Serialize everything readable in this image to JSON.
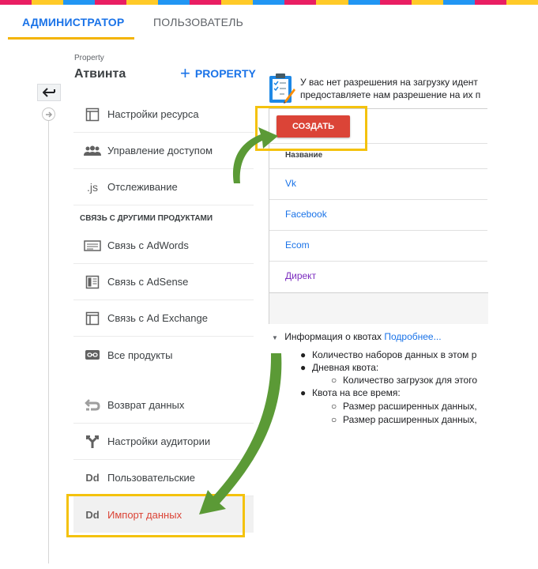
{
  "stripe": {
    "colors": [
      "#e91e63",
      "#ffca28",
      "#2196f3",
      "#e91e63",
      "#ffca28",
      "#2196f3",
      "#e91e63",
      "#ffca28",
      "#2196f3",
      "#e91e63",
      "#ffca28",
      "#2196f3",
      "#e91e63",
      "#ffca28",
      "#2196f3",
      "#e91e63",
      "#ffca28"
    ]
  },
  "tabs": {
    "admin": "АДМИНИСТРАТОР",
    "user": "ПОЛЬЗОВАТЕЛЬ"
  },
  "property": {
    "label": "Property",
    "name": "Атвинта",
    "add_button": "PROPERTY"
  },
  "menu": {
    "items": [
      {
        "label": "Настройки ресурса",
        "icon": "window-icon"
      },
      {
        "label": "Управление доступом",
        "icon": "people-icon"
      },
      {
        "label": "Отслеживание",
        "icon": "js-icon",
        "icon_text": ".js"
      }
    ],
    "section_title": "СВЯЗЬ С ДРУГИМИ ПРОДУКТАМИ",
    "links": [
      {
        "label": "Связь с AdWords",
        "icon": "adwords-icon"
      },
      {
        "label": "Связь с AdSense",
        "icon": "adsense-icon"
      },
      {
        "label": "Связь с Ad Exchange",
        "icon": "adexchange-icon"
      },
      {
        "label": "Все продукты",
        "icon": "link-icon"
      }
    ],
    "bottom": [
      {
        "label": "Возврат данных",
        "icon": "data-return-icon"
      },
      {
        "label": "Настройки аудитории",
        "icon": "audience-icon"
      },
      {
        "label": "Пользовательские",
        "icon": "dd-icon",
        "icon_text": "Dd"
      },
      {
        "label": "Импорт данных",
        "icon": "dd-icon",
        "icon_text": "Dd"
      }
    ]
  },
  "notice": {
    "line1": "У вас нет разрешения на загрузку идент",
    "line2": "предоставляете нам разрешение на их п"
  },
  "datasets": {
    "create_button": "СОЗДАТЬ",
    "column": "Название",
    "rows": [
      "Vk",
      "Facebook",
      "Ecom",
      "Директ"
    ]
  },
  "quota": {
    "title": "Информация о квотах",
    "more_link": "Подробнее...",
    "items": [
      {
        "text": "Количество наборов данных в этом р",
        "level": 1
      },
      {
        "text": "Дневная квота:",
        "level": 1
      },
      {
        "text": "Количество загрузок для этого",
        "level": 2
      },
      {
        "text": "Квота на все время:",
        "level": 1
      },
      {
        "text": "Размер расширенных данных,",
        "level": 2
      },
      {
        "text": "Размер расширенных данных,",
        "level": 2
      }
    ]
  },
  "colors": {
    "accent_blue": "#1a73e8",
    "create_red": "#db4437",
    "highlight_yellow": "#f4c20d",
    "arrow_green": "#5b9a36",
    "tab_underline": "#f4b400"
  }
}
